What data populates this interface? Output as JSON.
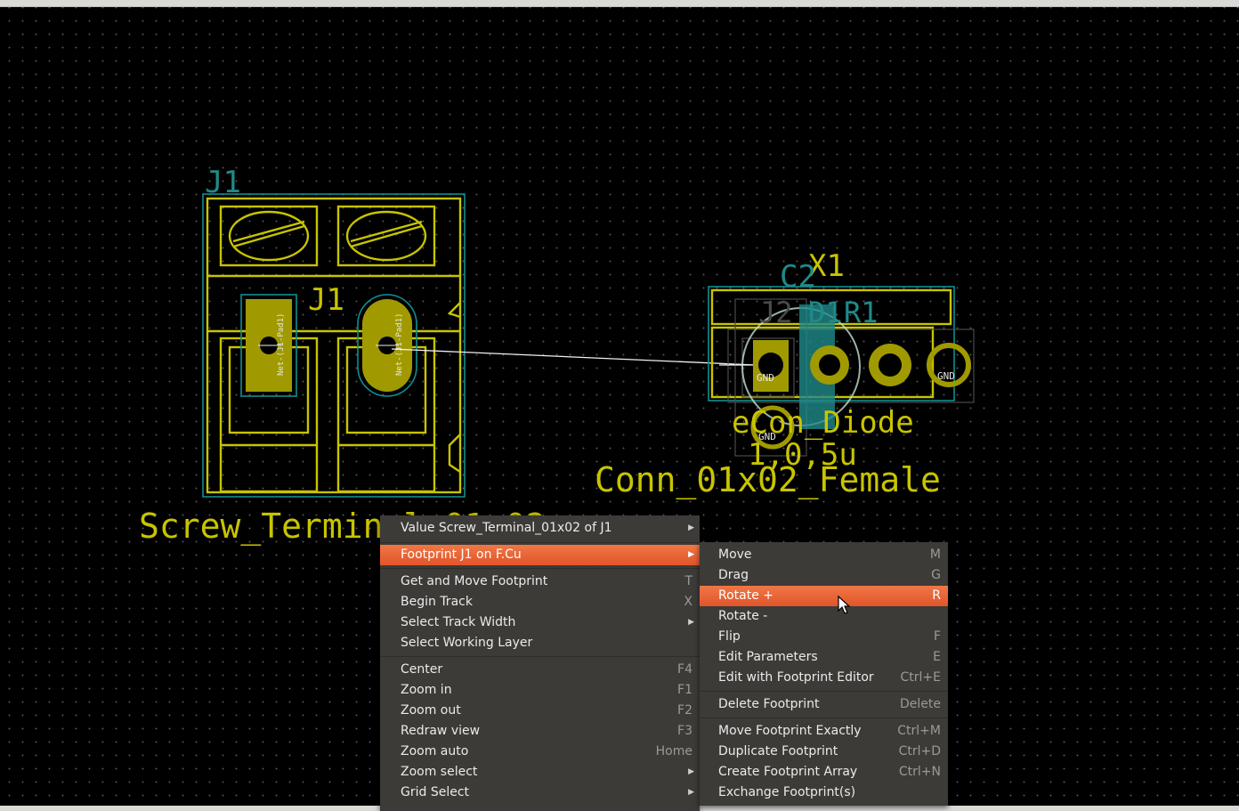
{
  "pcb": {
    "j1_ref_top": "J1",
    "j1_ref_center": "J1",
    "j1_value": "Screw_Terminal_01x02",
    "j1_pad_net_1": "Net-(J1-Pad1)",
    "j1_pad_net_2": "Net-(J1-Pad1)",
    "x1_ref": "X1",
    "c2_ref": "C2",
    "j2_ref": "J2",
    "d1_ref": "D1",
    "r1_ref": "R1",
    "gnd_label": "GND",
    "overlap_value_1": "eCon_Diode",
    "overlap_value_2": "1,0,5u",
    "conn_value": "Conn_01x02_Female"
  },
  "main_menu": {
    "items": [
      {
        "label": "Value Screw_Terminal_01x02 of J1",
        "shortcut": "",
        "submenu": true
      },
      {
        "label": "Footprint J1 on F.Cu",
        "shortcut": "",
        "submenu": true,
        "highlighted": true
      },
      {
        "label": "Get and Move Footprint",
        "shortcut": "T"
      },
      {
        "label": "Begin Track",
        "shortcut": "X"
      },
      {
        "label": "Select Track Width",
        "shortcut": "",
        "submenu": true
      },
      {
        "label": "Select Working Layer",
        "shortcut": ""
      },
      {
        "label": "Center",
        "shortcut": "F4"
      },
      {
        "label": "Zoom in",
        "shortcut": "F1"
      },
      {
        "label": "Zoom out",
        "shortcut": "F2"
      },
      {
        "label": "Redraw view",
        "shortcut": "F3"
      },
      {
        "label": "Zoom auto",
        "shortcut": "Home"
      },
      {
        "label": "Zoom select",
        "shortcut": "",
        "submenu": true
      },
      {
        "label": "Grid Select",
        "shortcut": "",
        "submenu": true
      }
    ]
  },
  "sub_menu": {
    "items": [
      {
        "label": "Move",
        "shortcut": "M"
      },
      {
        "label": "Drag",
        "shortcut": "G"
      },
      {
        "label": "Rotate +",
        "shortcut": "R",
        "highlighted": true
      },
      {
        "label": "Rotate -",
        "shortcut": ""
      },
      {
        "label": "Flip",
        "shortcut": "F"
      },
      {
        "label": "Edit Parameters",
        "shortcut": "E"
      },
      {
        "label": "Edit with Footprint Editor",
        "shortcut": "Ctrl+E"
      },
      {
        "label": "Delete Footprint",
        "shortcut": "Delete"
      },
      {
        "label": "Move Footprint Exactly",
        "shortcut": "Ctrl+M"
      },
      {
        "label": "Duplicate Footprint",
        "shortcut": "Ctrl+D"
      },
      {
        "label": "Create Footprint Array",
        "shortcut": "Ctrl+N"
      },
      {
        "label": "Exchange Footprint(s)",
        "shortcut": ""
      }
    ]
  },
  "colors": {
    "silkscreen": "#c8c400",
    "courtyard": "#0f8f8f",
    "reference_text": "#1f8a8a",
    "menu_bg": "#3c3b37",
    "menu_highlight": "#e95e34",
    "canvas_bg": "#000000"
  },
  "icons": {
    "mouse_cursor": "arrow-pointer",
    "submenu_indicator": "triangle-right"
  }
}
